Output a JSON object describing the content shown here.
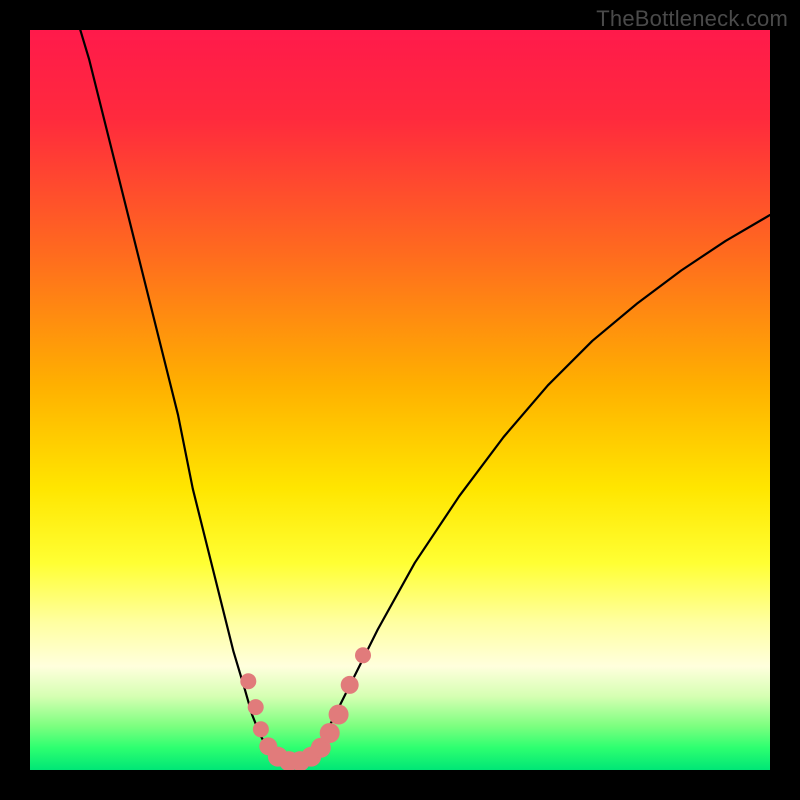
{
  "watermark": "TheBottleneck.com",
  "chart_data": {
    "type": "line",
    "title": "",
    "xlabel": "",
    "ylabel": "",
    "xlim": [
      0,
      100
    ],
    "ylim": [
      0,
      100
    ],
    "background_gradient": {
      "stops": [
        {
          "offset": 0.0,
          "color": "#ff1a4b"
        },
        {
          "offset": 0.12,
          "color": "#ff2a3d"
        },
        {
          "offset": 0.3,
          "color": "#ff6a1f"
        },
        {
          "offset": 0.48,
          "color": "#ffb000"
        },
        {
          "offset": 0.62,
          "color": "#ffe600"
        },
        {
          "offset": 0.72,
          "color": "#ffff33"
        },
        {
          "offset": 0.8,
          "color": "#ffffa0"
        },
        {
          "offset": 0.86,
          "color": "#ffffdd"
        },
        {
          "offset": 0.9,
          "color": "#d6ffb3"
        },
        {
          "offset": 0.94,
          "color": "#7eff80"
        },
        {
          "offset": 0.97,
          "color": "#2dff70"
        },
        {
          "offset": 1.0,
          "color": "#00e676"
        }
      ]
    },
    "series": [
      {
        "name": "left-branch",
        "stroke": "#000000",
        "stroke_width": 2.2,
        "x": [
          5,
          8,
          11,
          14,
          17,
          20,
          22,
          24,
          26,
          27.5,
          29,
          30,
          31,
          32,
          33
        ],
        "y": [
          106,
          96,
          84,
          72,
          60,
          48,
          38,
          30,
          22,
          16,
          11,
          7.5,
          5,
          3,
          2
        ]
      },
      {
        "name": "valley-floor",
        "stroke": "#000000",
        "stroke_width": 2.2,
        "x": [
          33,
          34,
          35,
          36,
          37,
          38
        ],
        "y": [
          2,
          1.2,
          1.0,
          1.0,
          1.2,
          2
        ]
      },
      {
        "name": "right-branch",
        "stroke": "#000000",
        "stroke_width": 2.2,
        "x": [
          38,
          40,
          43,
          47,
          52,
          58,
          64,
          70,
          76,
          82,
          88,
          94,
          100
        ],
        "y": [
          2,
          5,
          11,
          19,
          28,
          37,
          45,
          52,
          58,
          63,
          67.5,
          71.5,
          75
        ]
      }
    ],
    "markers": [
      {
        "name": "pink-dot",
        "x": 29.5,
        "y": 12.0,
        "r": 8,
        "color": "#e17b7b"
      },
      {
        "name": "pink-dot",
        "x": 30.5,
        "y": 8.5,
        "r": 8,
        "color": "#e17b7b"
      },
      {
        "name": "pink-dot",
        "x": 31.2,
        "y": 5.5,
        "r": 8,
        "color": "#e17b7b"
      },
      {
        "name": "pink-dot",
        "x": 32.2,
        "y": 3.2,
        "r": 9,
        "color": "#e17b7b"
      },
      {
        "name": "pink-dot",
        "x": 33.5,
        "y": 1.8,
        "r": 10,
        "color": "#e17b7b"
      },
      {
        "name": "pink-dot",
        "x": 35.0,
        "y": 1.2,
        "r": 10,
        "color": "#e17b7b"
      },
      {
        "name": "pink-dot",
        "x": 36.5,
        "y": 1.2,
        "r": 10,
        "color": "#e17b7b"
      },
      {
        "name": "pink-dot",
        "x": 38.0,
        "y": 1.8,
        "r": 10,
        "color": "#e17b7b"
      },
      {
        "name": "pink-dot",
        "x": 39.3,
        "y": 3.0,
        "r": 10,
        "color": "#e17b7b"
      },
      {
        "name": "pink-dot",
        "x": 40.5,
        "y": 5.0,
        "r": 10,
        "color": "#e17b7b"
      },
      {
        "name": "pink-dot",
        "x": 41.7,
        "y": 7.5,
        "r": 10,
        "color": "#e17b7b"
      },
      {
        "name": "pink-dot",
        "x": 43.2,
        "y": 11.5,
        "r": 9,
        "color": "#e17b7b"
      },
      {
        "name": "pink-dot",
        "x": 45.0,
        "y": 15.5,
        "r": 8,
        "color": "#e17b7b"
      }
    ]
  }
}
